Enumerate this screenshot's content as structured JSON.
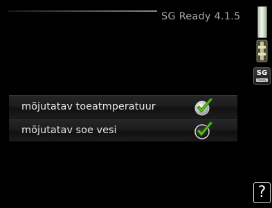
{
  "header": {
    "title": "SG Ready 4.1.5"
  },
  "side": {
    "scrollbar_icon": "scrollbar-icon",
    "slider_icon": "slider-icon",
    "sg_badge": {
      "text": "SG",
      "sub": "Ready"
    }
  },
  "settings": [
    {
      "label": "mõjutatav toeatmperatuur",
      "checked": true
    },
    {
      "label": "mõjutatav soe vesi",
      "checked": true
    }
  ],
  "help": {
    "label": "?"
  },
  "colors": {
    "background": "#000000",
    "check_green": "#5fbf1f",
    "text": "#e9e9e9"
  }
}
